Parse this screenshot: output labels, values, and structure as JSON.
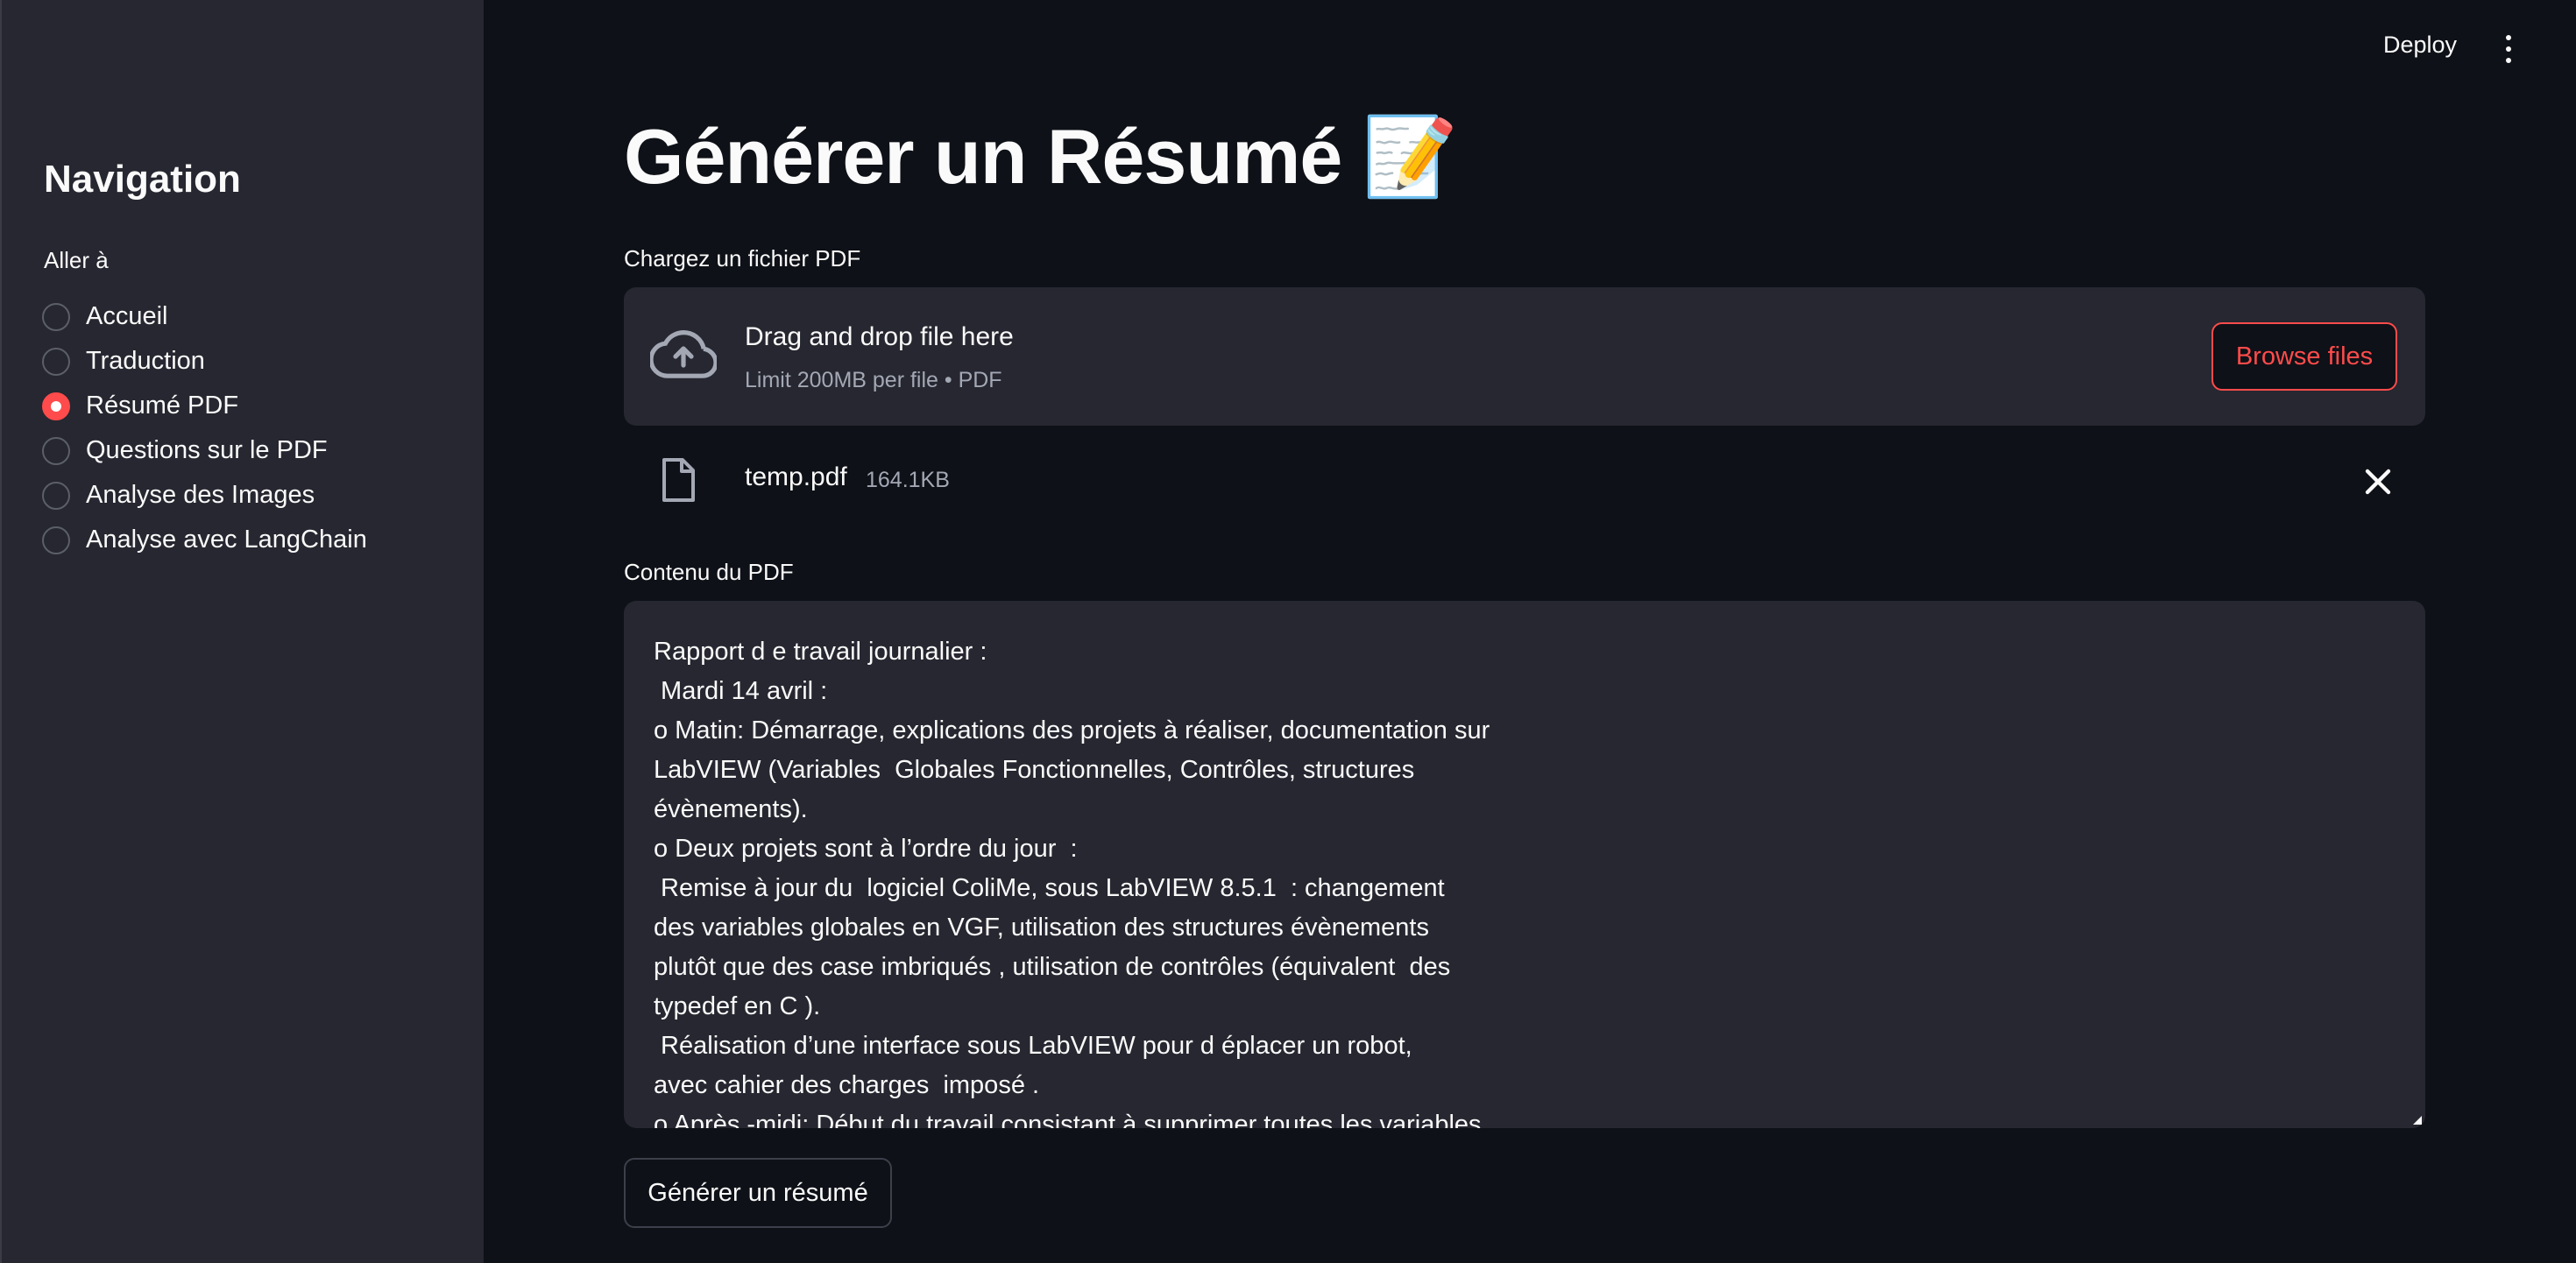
{
  "header": {
    "deploy_label": "Deploy",
    "menu_icon": "kebab-menu-icon"
  },
  "sidebar": {
    "title": "Navigation",
    "radio_label": "Aller à",
    "items": [
      {
        "label": "Accueil",
        "checked": false
      },
      {
        "label": "Traduction",
        "checked": false
      },
      {
        "label": "Résumé PDF",
        "checked": true
      },
      {
        "label": "Questions sur le PDF",
        "checked": false
      },
      {
        "label": "Analyse des Images",
        "checked": false
      },
      {
        "label": "Analyse avec LangChain",
        "checked": false
      }
    ]
  },
  "main": {
    "title": "Générer un Résumé 📝",
    "uploader": {
      "label": "Chargez un fichier PDF",
      "drop_text": "Drag and drop file here",
      "limit_text": "Limit 200MB per file • PDF",
      "browse_label": "Browse files",
      "icon": "cloud-upload-icon"
    },
    "file": {
      "name": "temp.pdf",
      "size": "164.1KB",
      "icon": "file-icon",
      "remove_icon": "close-icon"
    },
    "content": {
      "label": "Contenu du PDF",
      "text": "Rapport d e travail journalier :\n Mardi 14 avril :\no Matin: Démarrage, explications des projets à réaliser, documentation sur\nLabVIEW (Variables  Globales Fonctionnelles, Contrôles, structures\névènements).\no Deux projets sont à l’ordre du jour  :\n Remise à jour du  logiciel ColiMe, sous LabVIEW 8.5.1  : changement\ndes variables globales en VGF, utilisation des structures évènements\nplutôt que des case imbriqués , utilisation de contrôles (équivalent  des\ntypedef en C ).\n Réalisation d’une interface sous LabVIEW pour d éplacer un robot,\navec cahier des charges  imposé .\no Après -midi: Début du travail consistant à supprimer toutes les variables"
    },
    "generate_label": "Générer un résumé"
  },
  "colors": {
    "background": "#0e1117",
    "sidebar": "#262730",
    "accent": "#ff4b4b",
    "text": "#fafafa",
    "muted": "#a3a8b4"
  }
}
